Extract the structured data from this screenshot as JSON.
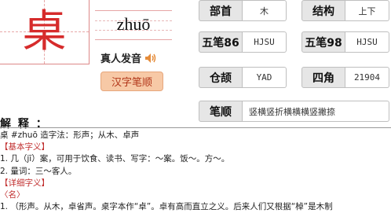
{
  "character": "桌",
  "pinyin": "zhuō",
  "audio": {
    "label": "真人发音",
    "icon": "speaker-icon"
  },
  "stroke_button": "汉字笔顺",
  "info": {
    "radical": {
      "label": "部首",
      "value": "木"
    },
    "structure": {
      "label": "结构",
      "value": "上下"
    },
    "wubi86": {
      "label": "五笔86",
      "value": "HJSU"
    },
    "wubi98": {
      "label": "五笔98",
      "value": "HJSU"
    },
    "cangjie": {
      "label": "仓颉",
      "value": "YAD"
    },
    "four_corner": {
      "label": "四角",
      "value": "21904"
    },
    "stroke_order": {
      "label": "笔顺",
      "value": "竖横竖折横横横竖撇捺"
    }
  },
  "explain": {
    "title": "解 释 ：",
    "lines": [
      "桌  #zhuō  造字法：形声；从木、卓声",
      "【基本字义】",
      "1. 几（jī）案，可用于饮食、读书、写字：～案。饭～。方～。",
      "2. 量词：三～客人。",
      "【详细字义】",
      "〈名〉",
      "1. （形声。从木，卓省声。桌字本作“卓”。卓有高而直立之义。后来人们又根据“棹”是木制"
    ]
  }
}
